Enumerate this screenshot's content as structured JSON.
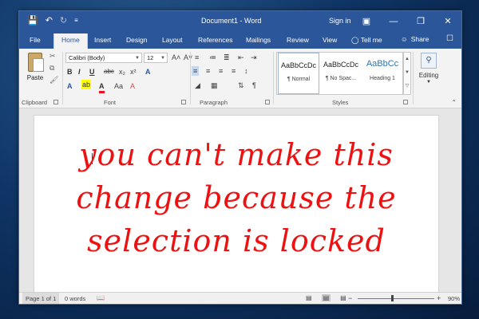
{
  "window": {
    "title": "Document1 - Word",
    "sign_in": "Sign in"
  },
  "qat": {
    "save_icon": "save-icon",
    "undo_icon": "undo-icon",
    "redo_icon": "redo-icon"
  },
  "tabs": [
    {
      "label": "File"
    },
    {
      "label": "Home"
    },
    {
      "label": "Insert"
    },
    {
      "label": "Design"
    },
    {
      "label": "Layout"
    },
    {
      "label": "References"
    },
    {
      "label": "Mailings"
    },
    {
      "label": "Review"
    },
    {
      "label": "View"
    },
    {
      "label": "Tell me"
    }
  ],
  "share_label": "Share",
  "ribbon": {
    "clipboard": {
      "paste_label": "Paste",
      "group_label": "Clipboard"
    },
    "font": {
      "font_name": "Calibri (Body)",
      "font_size": "12",
      "group_label": "Font",
      "bold": "B",
      "italic": "I",
      "underline": "U",
      "strike": "abc",
      "subscript": "x₂",
      "superscript": "x²",
      "grow": "A˄",
      "shrink": "A˅",
      "case": "Aa",
      "clear": "A"
    },
    "paragraph": {
      "group_label": "Paragraph"
    },
    "styles": {
      "group_label": "Styles",
      "items": [
        {
          "sample": "AaBbCcDc",
          "name": "¶ Normal"
        },
        {
          "sample": "AaBbCcDc",
          "name": "¶ No Spac..."
        },
        {
          "sample": "AaBbCc",
          "name": "Heading 1"
        }
      ]
    },
    "editing": {
      "label": "Editing"
    }
  },
  "document": {
    "lines": [
      "you can't make this",
      "change because the",
      "selection is locked"
    ]
  },
  "status": {
    "page": "Page 1 of 1",
    "words": "0 words",
    "zoom": "90%",
    "zoom_fraction": 0.45
  },
  "colors": {
    "accent": "#2b579a",
    "text_red": "#ee1111"
  }
}
